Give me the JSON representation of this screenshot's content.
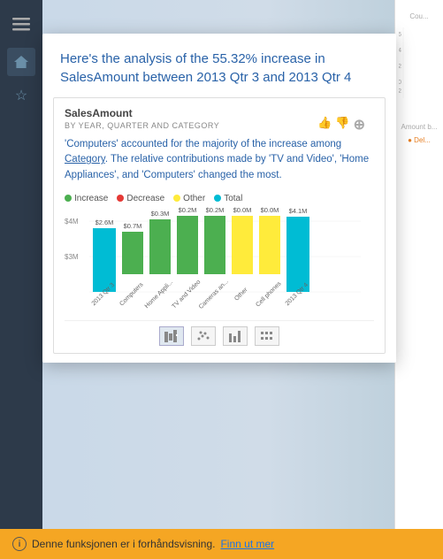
{
  "card": {
    "title_blue": "Here's the analysis of the 55.32% increase in SalesAmount between 2013 Qtr 3 and 2013 Qtr 4",
    "chart": {
      "title": "SalesAmount",
      "subtitle": "BY YEAR, QUARTER AND CATEGORY",
      "description_part1": "'Computers' accounted for the majority of the increase among ",
      "description_link": "Category",
      "description_part2": ". The relative contributions made by 'TV and Video', 'Home Appliances', and 'Computers' changed the most.",
      "legend": [
        {
          "label": "Increase",
          "color": "#4caf50"
        },
        {
          "label": "Decrease",
          "color": "#e53935"
        },
        {
          "label": "Other",
          "color": "#ffeb3b"
        },
        {
          "label": "Total",
          "color": "#00bcd4"
        }
      ],
      "bars": [
        {
          "label": "2013 Qtr 3",
          "value": "$2.6M",
          "height": 72,
          "color": "#00bcd4",
          "offset": 0
        },
        {
          "label": "Computers",
          "value": "$0.7M",
          "height": 20,
          "color": "#4caf50",
          "offset": 52
        },
        {
          "label": "Home Appli...",
          "value": "$0.3M",
          "height": 9,
          "color": "#4caf50",
          "offset": 63
        },
        {
          "label": "TV and Video",
          "value": "$0.2M",
          "height": 6,
          "color": "#4caf50",
          "offset": 66
        },
        {
          "label": "Cameras an...",
          "value": "$0.2M",
          "height": 6,
          "color": "#4caf50",
          "offset": 60
        },
        {
          "label": "Other",
          "value": "$0.0M",
          "height": 2,
          "color": "#ffeb3b",
          "offset": 69
        },
        {
          "label": "Cell phones",
          "value": "$0.0M",
          "height": 2,
          "color": "#ffeb3b",
          "offset": 68
        },
        {
          "label": "2013 Qtr 4",
          "value": "$4.1M",
          "height": 85,
          "color": "#00bcd4",
          "offset": 0
        }
      ],
      "y_labels": [
        "$4M",
        "$3M"
      ],
      "toolbar_icons": [
        "▦",
        "⊞",
        "▐▌",
        "≡"
      ]
    }
  },
  "preview_bar": {
    "text": "Denne funksjonen er i forhåndsvisning.",
    "link_text": "Finn ut mer"
  }
}
